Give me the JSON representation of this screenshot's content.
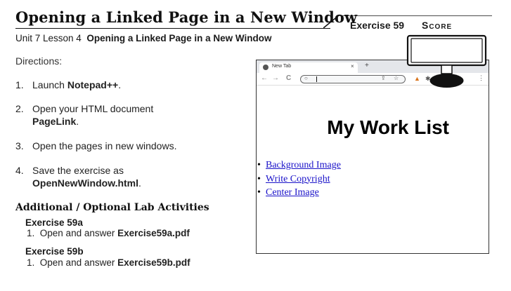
{
  "header": {
    "title": "Opening a Linked Page in a New Window",
    "exercise_label": "Exercise 59",
    "score_label": "Score"
  },
  "subtitle": {
    "unit": "Unit 7 Lesson 4",
    "lesson": "Opening a Linked Page in a New Window"
  },
  "directions_label": "Directions:",
  "steps": [
    {
      "num": "1.",
      "pre": "Launch ",
      "bold": "Notepad++",
      "post": "."
    },
    {
      "num": "2.",
      "pre": "Open your HTML document",
      "bold": "PageLink",
      "post": "."
    },
    {
      "num": "3.",
      "pre": "Open the pages in new windows.",
      "bold": "",
      "post": ""
    },
    {
      "num": "4.",
      "pre": "Save the exercise as",
      "bold": "OpenNewWindow.html",
      "post": "."
    }
  ],
  "additional": {
    "heading": "Additional / Optional Lab Activities",
    "items": [
      {
        "title": "Exercise 59a",
        "num": "1.",
        "text": "Open and answer ",
        "file": "Exercise59a.pdf"
      },
      {
        "title": "Exercise 59b",
        "num": "1.",
        "text": "Open and answer ",
        "file": "Exercise59b.pdf"
      }
    ]
  },
  "browser": {
    "tab_title": "New Tab",
    "tab_close": "×",
    "tab_plus": "+",
    "page_heading": "My Work List",
    "links": [
      "Background Image",
      "Write Copyright",
      "Center Image"
    ],
    "window_controls": {
      "chevron": "⌄",
      "minimize": "—",
      "maximize": "□",
      "close": "✕"
    },
    "nav": {
      "back": "←",
      "forward": "→",
      "reload": "C"
    },
    "icons": {
      "search": "🔍",
      "share": "⇪",
      "star": "☆",
      "extension": "🦊",
      "puzzle": "✱",
      "menu": "⋮"
    }
  }
}
